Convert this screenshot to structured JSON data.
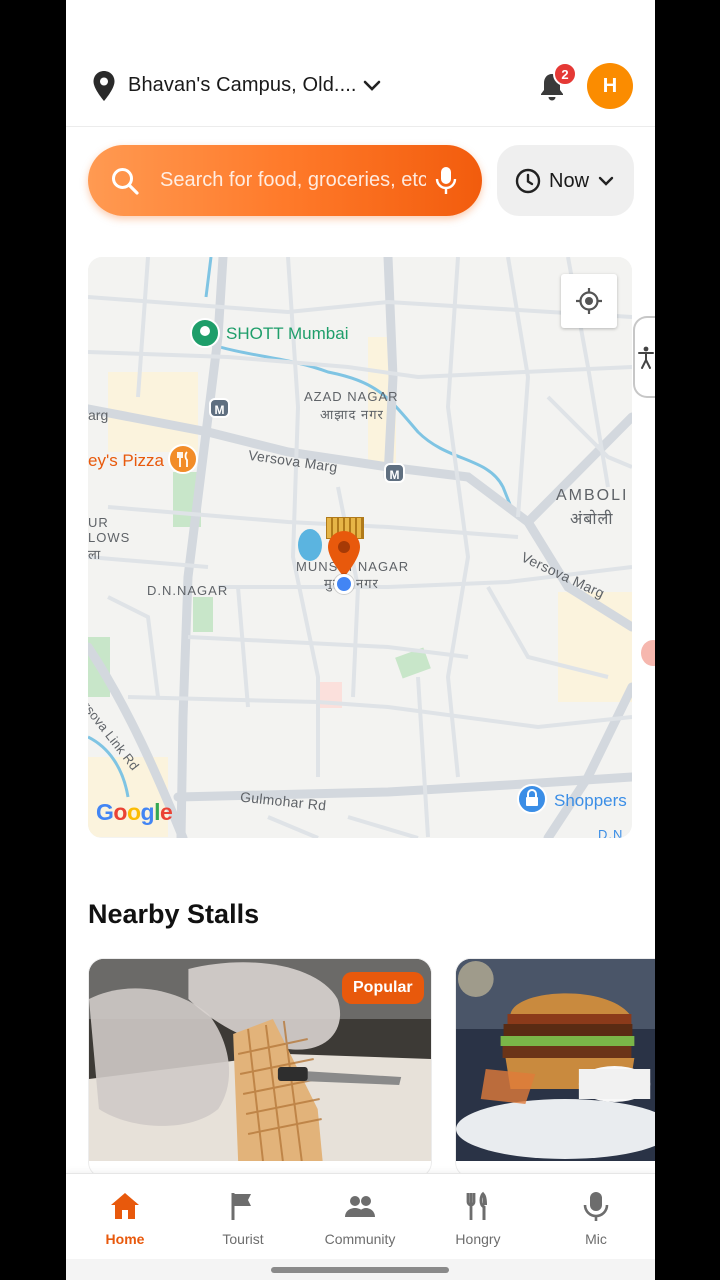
{
  "header": {
    "location": "Bhavan's Campus, Old....",
    "notification_count": "2",
    "avatar_initial": "H"
  },
  "search": {
    "placeholder": "Search for food, groceries, etc",
    "time_label": "Now"
  },
  "map": {
    "labels": {
      "shott": "SHOTT Mumbai",
      "azad_en": "AZAD NAGAR",
      "azad_hi": "आझाद नगर",
      "pizza": "ey's Pizza",
      "versova_marg_1": "Versova Marg",
      "versova_marg_2": "Versova Marg",
      "amboli_en": "AMBOLI",
      "amboli_hi": "अंबोली",
      "munshi_en": "MUNSHI NAGAR",
      "munshi_hi": "मुन्शी नगर",
      "dn_nagar": "D.N.NAGAR",
      "bungalows_1": "UR",
      "bungalows_2": "LOWS",
      "bungalows_3": "ला",
      "arg": "arg",
      "link_rd": "Versova Link Rd",
      "gulmohar": "Gulmohar Rd",
      "shoppers": "Shoppers",
      "dn_edge": "D.N",
      "metro": "M",
      "google": "Google"
    },
    "colors": {
      "road": "#d6dbe0",
      "water": "#7fc4e3",
      "park": "#c8e6c9",
      "pin": "#e8590c"
    }
  },
  "nearby": {
    "title": "Nearby Stalls",
    "cards": [
      {
        "badge": "Popular"
      }
    ]
  },
  "nav": {
    "items": [
      {
        "label": "Home",
        "icon": "home-icon",
        "active": true
      },
      {
        "label": "Tourist",
        "icon": "flag-icon"
      },
      {
        "label": "Community",
        "icon": "people-icon"
      },
      {
        "label": "Hongry",
        "icon": "fork-knife-icon"
      },
      {
        "label": "Mic",
        "icon": "mic-icon"
      }
    ]
  }
}
